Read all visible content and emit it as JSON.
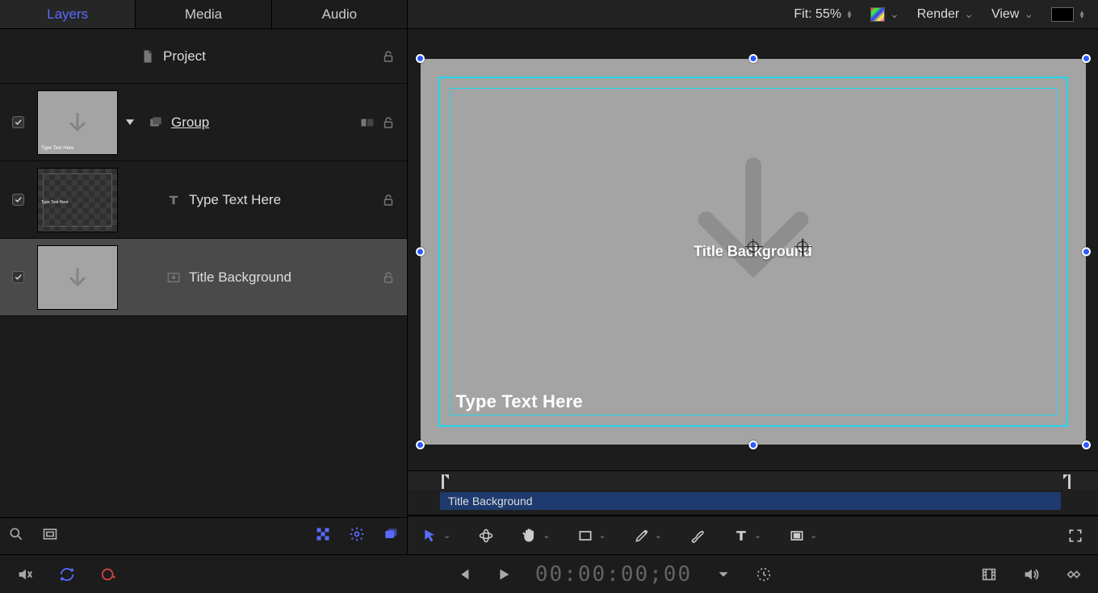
{
  "tabs": {
    "layers": "Layers",
    "media": "Media",
    "audio": "Audio"
  },
  "layers": {
    "project": "Project",
    "group": "Group",
    "text_layer": "Type Text Here",
    "title_bg": "Title Background"
  },
  "viewer_bar": {
    "fit": "Fit: 55%",
    "render": "Render",
    "view": "View"
  },
  "canvas": {
    "title_label": "Title Background",
    "type_text": "Type Text Here"
  },
  "mini_timeline": {
    "clip_label": "Title Background"
  },
  "transport": {
    "timecode": "00:00:00;00"
  }
}
